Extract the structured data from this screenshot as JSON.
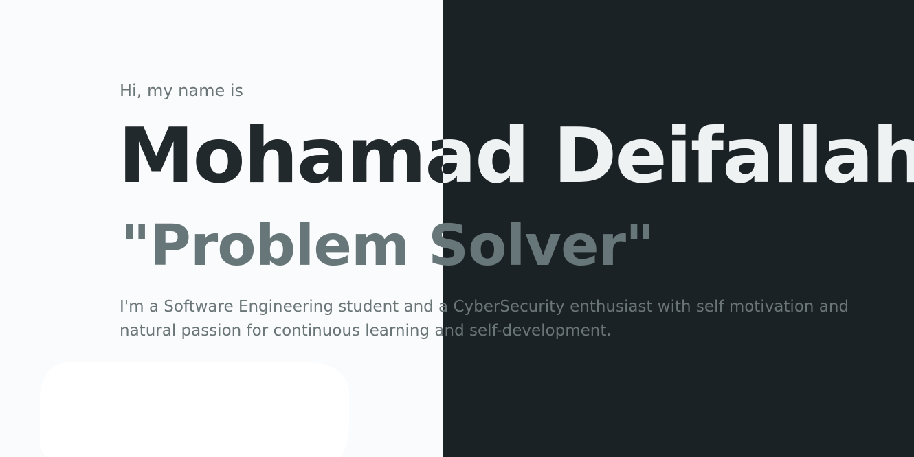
{
  "hero": {
    "greeting": "Hi, my name is",
    "name": "Mohamad Deifallah",
    "tagline": "\"Problem Solver\"",
    "intro": "I'm a Software Engineering student and a CyberSecurity enthusiast with self motivation and natural passion for continuous learning and self-development."
  },
  "colors": {
    "light_background": "#fafbfc",
    "dark_background": "#1b2225",
    "name_on_light": "#22292c",
    "name_on_dark": "#eef2f3",
    "muted_text": "#6a7578"
  }
}
